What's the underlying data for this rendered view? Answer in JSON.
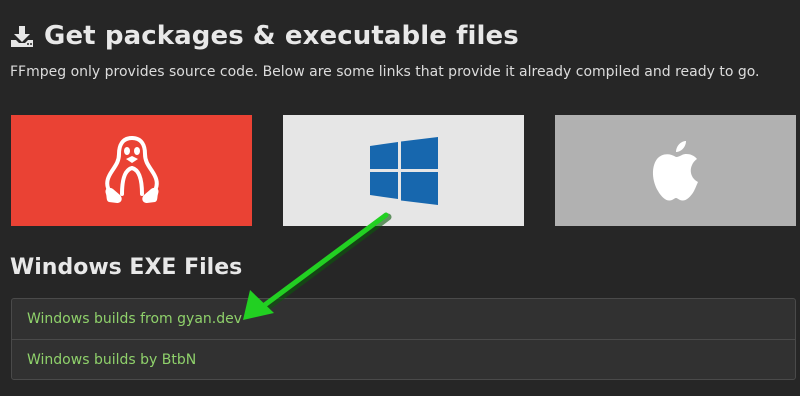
{
  "header": {
    "title": "Get packages & executable files",
    "intro": "FFmpeg only provides source code. Below are some links that provide it already compiled and ready to go."
  },
  "os_tiles": [
    {
      "os": "linux",
      "icon": "linux-tux-icon",
      "color": "#ea4234"
    },
    {
      "os": "windows",
      "icon": "windows-logo-icon",
      "color": "#e6e6e6"
    },
    {
      "os": "macos",
      "icon": "apple-logo-icon",
      "color": "#b1b1b1"
    }
  ],
  "section": {
    "title": "Windows EXE Files"
  },
  "builds": [
    {
      "label": "Windows builds from gyan.dev"
    },
    {
      "label": "Windows builds by BtbN"
    }
  ],
  "colors": {
    "background": "#262626",
    "link": "#8fd16b",
    "windows_blue": "#1767ae",
    "annotation_arrow": "#22d022"
  }
}
